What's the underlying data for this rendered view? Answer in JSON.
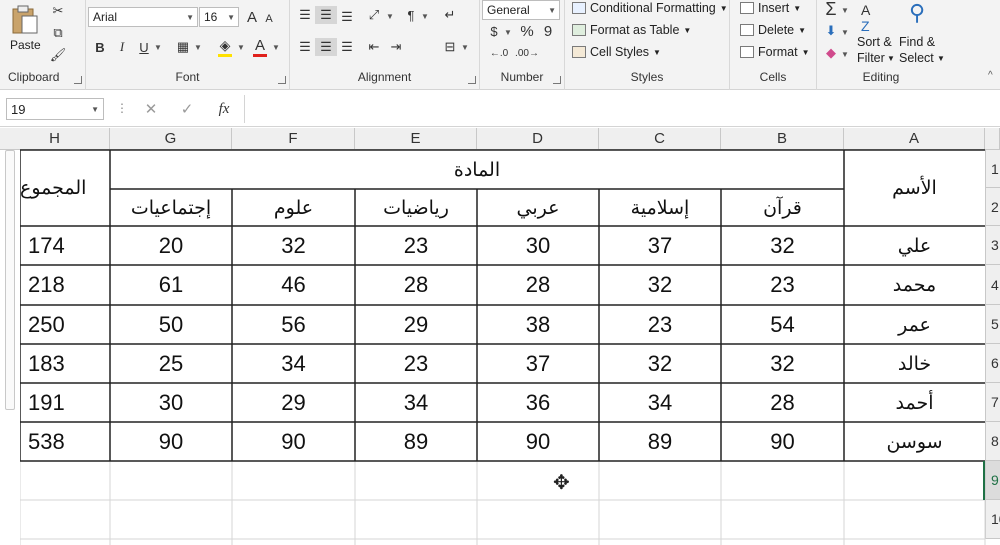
{
  "ribbon": {
    "clipboard": {
      "label": "Clipboard",
      "paste": "Paste"
    },
    "font": {
      "label": "Font",
      "name": "Arial",
      "size": "16",
      "bold": "B",
      "italic": "I",
      "underline": "U",
      "grow": "A",
      "shrink": "A",
      "font_color_glyph": "A",
      "font_color": "#e0201b",
      "fill_color": "#ffe100"
    },
    "alignment": {
      "label": "Alignment"
    },
    "number": {
      "label": "Number",
      "format": "General",
      "percent": "%",
      "comma": "9"
    },
    "styles": {
      "label": "Styles",
      "conditional": "Conditional Formatting",
      "format_table": "Format as Table",
      "cell_styles": "Cell Styles"
    },
    "cells": {
      "label": "Cells",
      "insert": "Insert",
      "delete": "Delete",
      "format": "Format"
    },
    "editing": {
      "label": "Editing",
      "sum": "Σ",
      "sort_1": "Sort &",
      "sort_2": "Filter",
      "find_1": "Find &",
      "find_2": "Select"
    }
  },
  "formula_bar": {
    "name_box": "19",
    "cancel": "✕",
    "enter": "✓",
    "fx": "fx",
    "value": ""
  },
  "columns": [
    "H",
    "G",
    "F",
    "E",
    "D",
    "C",
    "B",
    "A"
  ],
  "rows": [
    "1",
    "2",
    "3",
    "4",
    "5",
    "6",
    "7",
    "8",
    "9",
    "10"
  ],
  "table": {
    "subject_header": "المادة",
    "name_header": "الأسم",
    "total_header": "المجموع",
    "subjects": [
      "إجتماعيات",
      "علوم",
      "رياضيات",
      "عربي",
      "إسلامية",
      "قرآن"
    ],
    "students": [
      {
        "name": "علي",
        "scores": [
          "20",
          "32",
          "23",
          "30",
          "37",
          "32"
        ],
        "total": "174"
      },
      {
        "name": "محمد",
        "scores": [
          "61",
          "46",
          "28",
          "28",
          "32",
          "23"
        ],
        "total": "218"
      },
      {
        "name": "عمر",
        "scores": [
          "50",
          "56",
          "29",
          "38",
          "23",
          "54"
        ],
        "total": "250"
      },
      {
        "name": "خالد",
        "scores": [
          "25",
          "34",
          "23",
          "37",
          "32",
          "32"
        ],
        "total": "183"
      },
      {
        "name": "أحمد",
        "scores": [
          "30",
          "29",
          "34",
          "36",
          "34",
          "28"
        ],
        "total": "191"
      },
      {
        "name": "سوسن",
        "scores": [
          "90",
          "90",
          "89",
          "90",
          "89",
          "90"
        ],
        "total": "538"
      }
    ]
  }
}
